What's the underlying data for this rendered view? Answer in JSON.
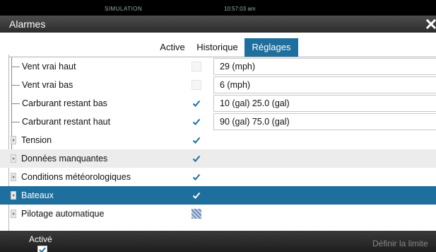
{
  "statusbar": {
    "mode": "SIMULATION",
    "clock": "10:57:03 am"
  },
  "window": {
    "title": "Alarmes"
  },
  "tabs": [
    {
      "label": "Active",
      "selected": false
    },
    {
      "label": "Historique",
      "selected": false
    },
    {
      "label": "Réglages",
      "selected": true
    }
  ],
  "rows": [
    {
      "label": "Vent vrai haut",
      "checked": false,
      "value": "29 (mph)"
    },
    {
      "label": "Vent vrai bas",
      "checked": false,
      "value": "6 (mph)"
    },
    {
      "label": "Carburant restant bas",
      "checked": true,
      "value": "10 (gal)  25.0 (gal)"
    },
    {
      "label": "Carburant restant haut",
      "checked": true,
      "value": "90 (gal)  75.0 (gal)"
    },
    {
      "label": "Tension",
      "checked": true
    },
    {
      "label": "Données manquantes",
      "checked": true
    },
    {
      "label": "Conditions météorologiques",
      "checked": true
    },
    {
      "label": "Bateaux",
      "checked": true,
      "selected": true
    },
    {
      "label": "Pilotage automatique",
      "checked": "partial"
    }
  ],
  "footer": {
    "enabled_label": "Activé",
    "enabled": true,
    "define_limit": "Définir la limite"
  },
  "colors": {
    "accent": "#1e6f9e"
  }
}
